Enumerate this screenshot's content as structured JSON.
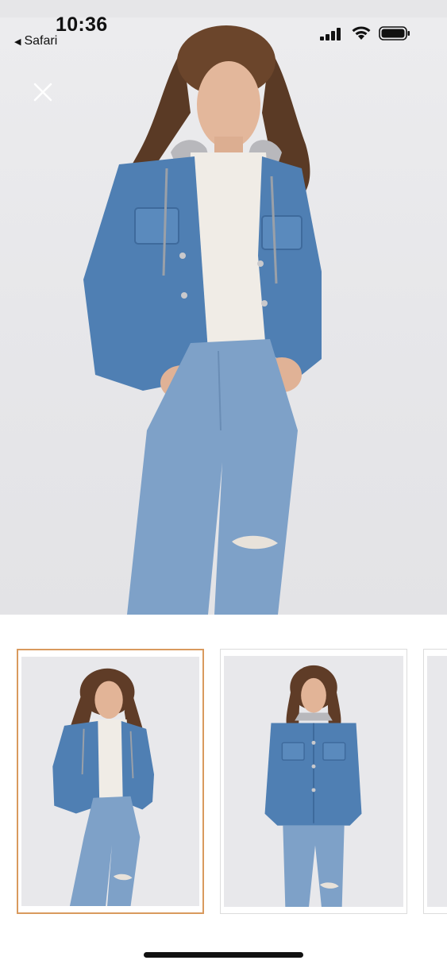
{
  "status_bar": {
    "time": "10:36",
    "back_app": "Safari",
    "back_icon": "back-triangle-icon",
    "signal_icon": "cellular-signal-icon",
    "wifi_icon": "wifi-icon",
    "battery_icon": "battery-icon"
  },
  "viewer": {
    "close_icon": "close-icon",
    "main_image": "model-denim-jacket-hood-front",
    "selected_index": 0
  },
  "thumbnails": [
    {
      "image": "model-denim-jacket-hands-in-pockets",
      "selected": true
    },
    {
      "image": "model-denim-jacket-buttoned-front",
      "selected": false
    },
    {
      "image": "next-image-partial",
      "selected": false
    }
  ],
  "colors": {
    "selected_border": "#d99a5e",
    "denim": "#4f7fb3",
    "jeans": "#7ea1c8",
    "background": "#e8e8eb"
  }
}
